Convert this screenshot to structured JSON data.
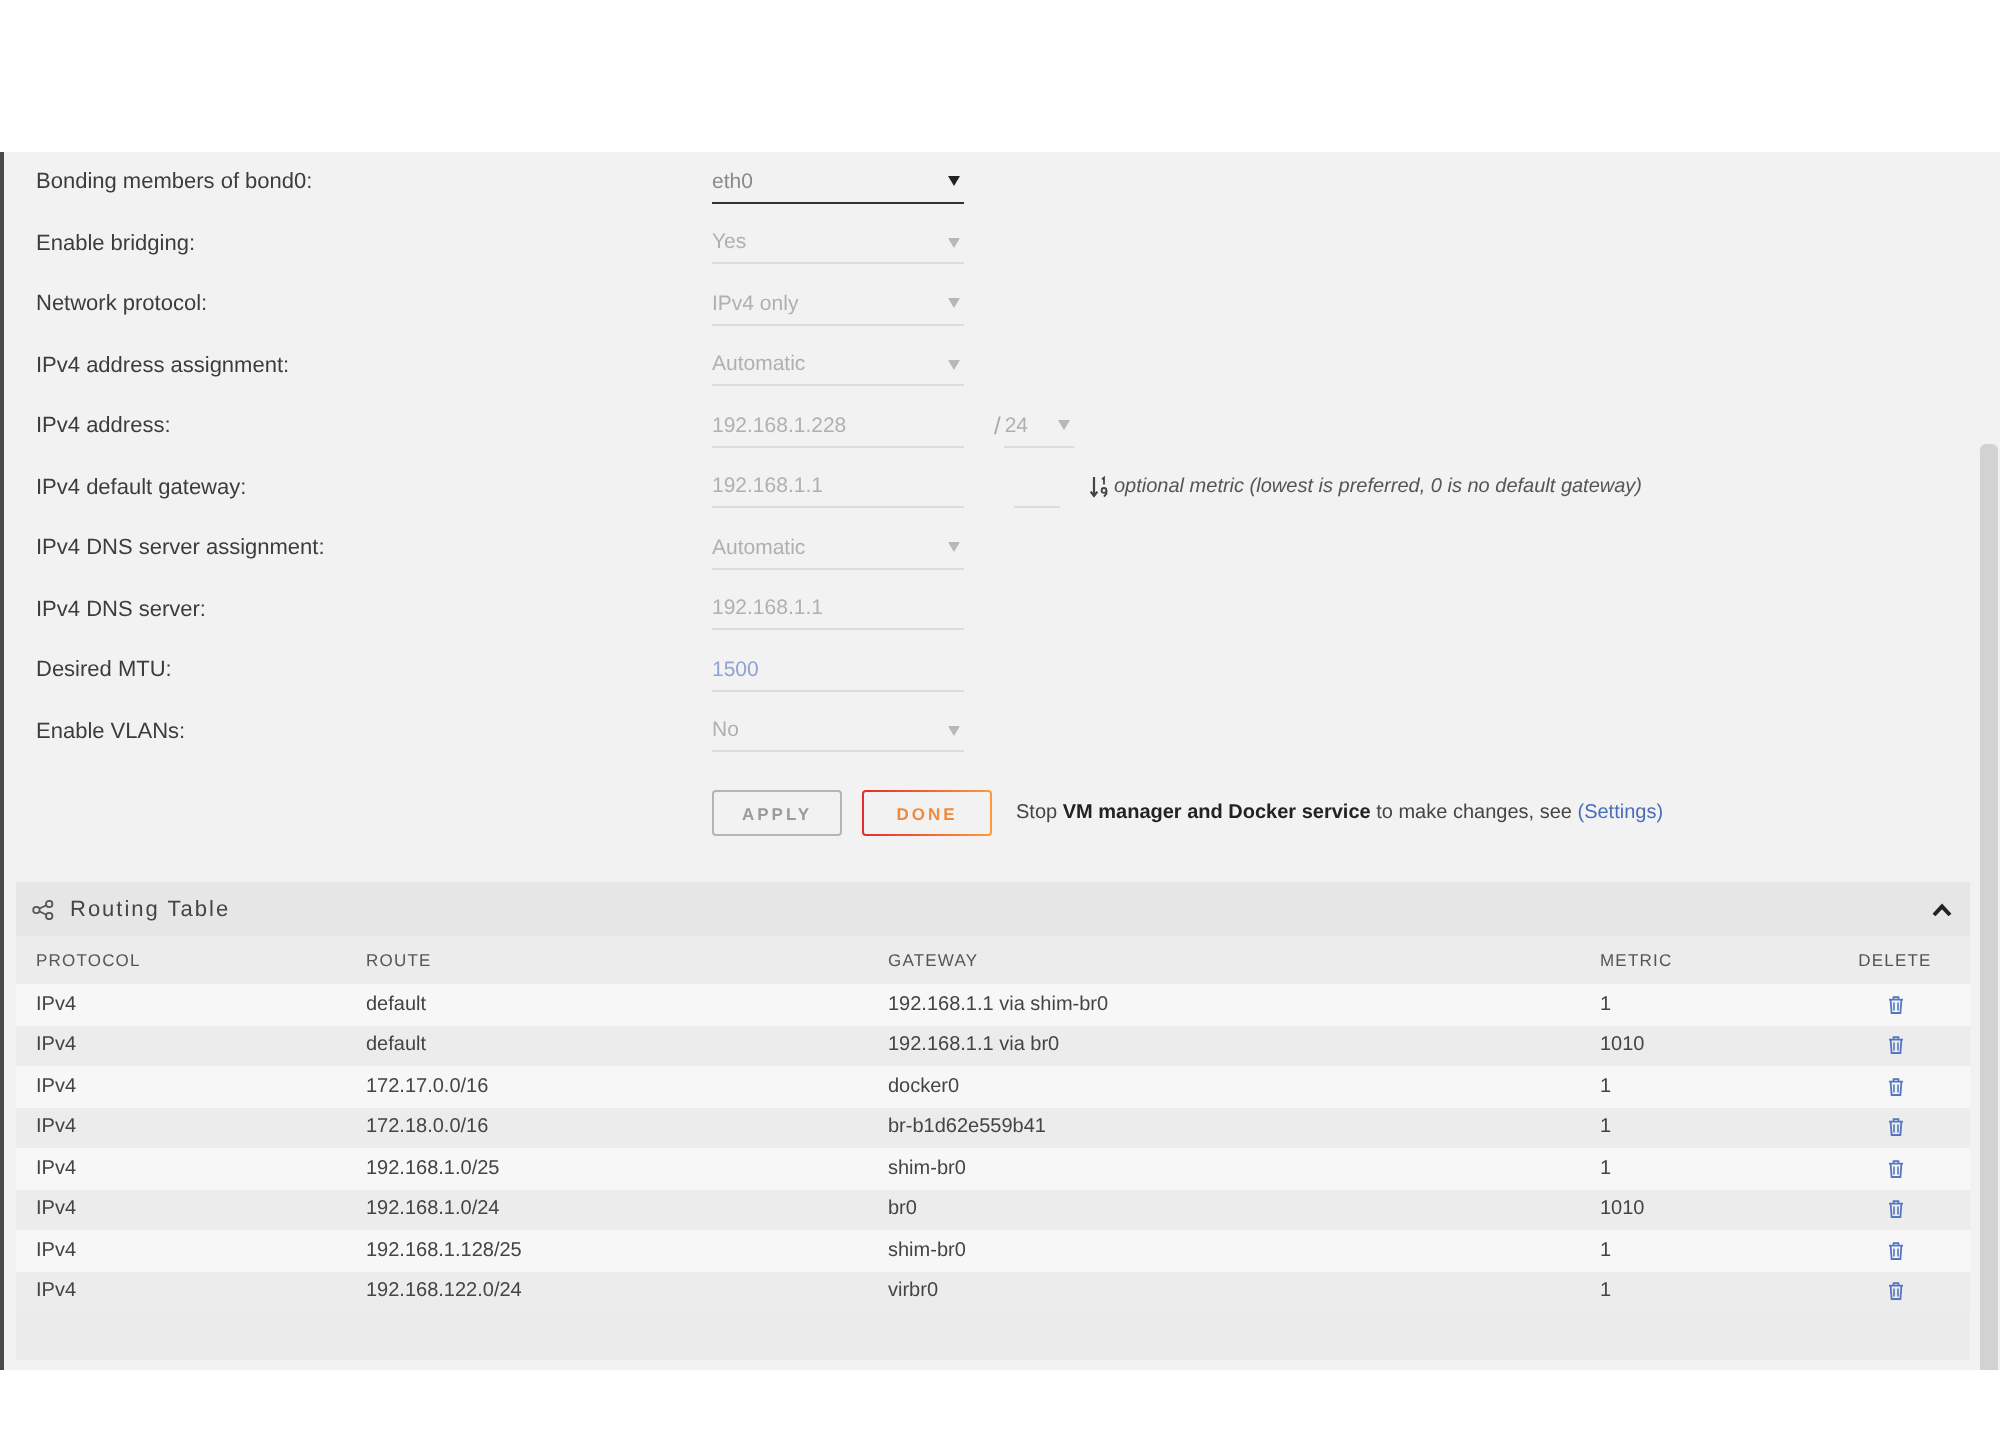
{
  "form": {
    "rows": [
      {
        "kind": "select",
        "label": "Bonding members of bond0:",
        "value": "eth0",
        "disabled": false
      },
      {
        "kind": "select",
        "label": "Enable bridging:",
        "value": "Yes",
        "disabled": true
      },
      {
        "kind": "select",
        "label": "Network protocol:",
        "value": "IPv4 only",
        "disabled": true
      },
      {
        "kind": "select",
        "label": "IPv4 address assignment:",
        "value": "Automatic",
        "disabled": true
      },
      {
        "kind": "address",
        "label": "IPv4 address:",
        "value": "192.168.1.228",
        "disabled": true,
        "separator": "/",
        "prefix": "24"
      },
      {
        "kind": "gateway",
        "label": "IPv4 default gateway:",
        "value": "192.168.1.1",
        "disabled": true,
        "hint": "optional metric (lowest is preferred, 0 is no default gateway)"
      },
      {
        "kind": "select",
        "label": "IPv4 DNS server assignment:",
        "value": "Automatic",
        "disabled": true
      },
      {
        "kind": "input",
        "label": "IPv4 DNS server:",
        "value": "192.168.1.1",
        "disabled": true
      },
      {
        "kind": "input",
        "label": "Desired MTU:",
        "placeholder": "1500",
        "disabled": true
      },
      {
        "kind": "select",
        "label": "Enable VLANs:",
        "value": "No",
        "disabled": true
      }
    ]
  },
  "buttons": [
    {
      "label": "APPLY",
      "disabled": true
    },
    {
      "label": "DONE",
      "disabled": false
    }
  ],
  "notice": {
    "text": "Stop **VM manager and Docker service** to make changes, see ",
    "link": "(Settings)"
  },
  "routing_table": {
    "title": "Routing Table",
    "expanded": true,
    "columns": [
      "PROTOCOL",
      "ROUTE",
      "GATEWAY",
      "METRIC",
      "DELETE"
    ],
    "rows": [
      {
        "protocol": "IPv4",
        "route": "default",
        "gateway": "192.168.1.1 via shim-br0",
        "metric": "1"
      },
      {
        "protocol": "IPv4",
        "route": "default",
        "gateway": "192.168.1.1 via br0",
        "metric": "1010"
      },
      {
        "protocol": "IPv4",
        "route": "172.17.0.0/16",
        "gateway": "docker0",
        "metric": "1"
      },
      {
        "protocol": "IPv4",
        "route": "172.18.0.0/16",
        "gateway": "br-b1d62e559b41",
        "metric": "1"
      },
      {
        "protocol": "IPv4",
        "route": "192.168.1.0/25",
        "gateway": "shim-br0",
        "metric": "1"
      },
      {
        "protocol": "IPv4",
        "route": "192.168.1.0/24",
        "gateway": "br0",
        "metric": "1010"
      },
      {
        "protocol": "IPv4",
        "route": "192.168.1.128/25",
        "gateway": "shim-br0",
        "metric": "1"
      },
      {
        "protocol": "IPv4",
        "route": "192.168.122.0/24",
        "gateway": "virbr0",
        "metric": "1"
      }
    ]
  }
}
